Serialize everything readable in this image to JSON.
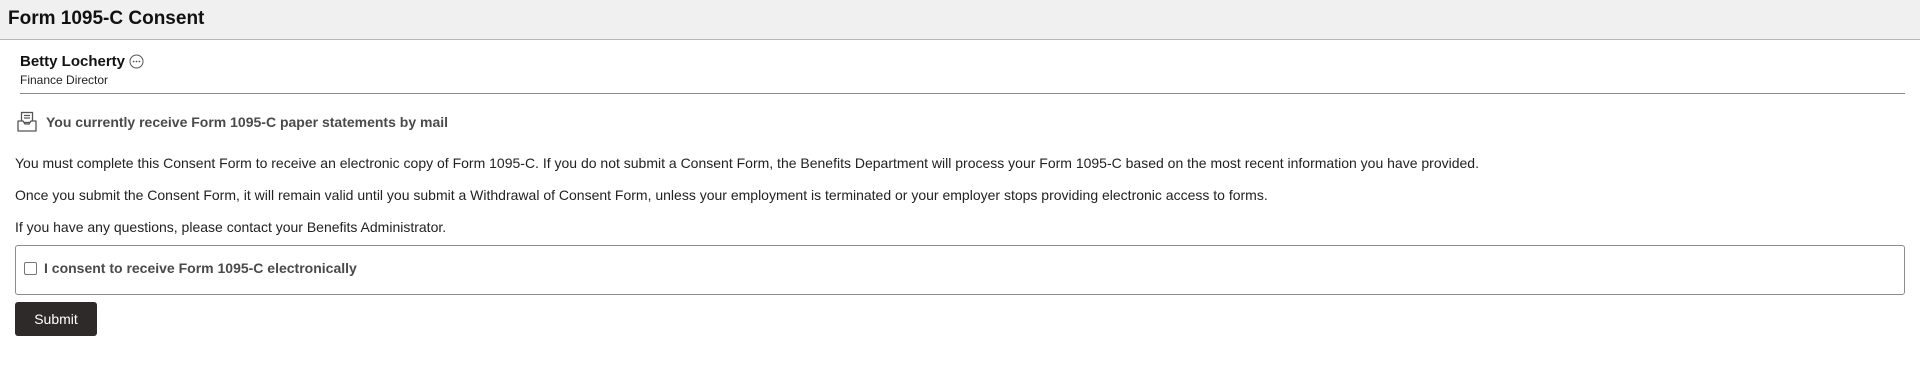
{
  "header": {
    "title": "Form 1095-C Consent"
  },
  "person": {
    "name": "Betty Locherty",
    "role": "Finance Director",
    "more_icon": "more-options-icon"
  },
  "notice": {
    "icon": "mail-tray-icon",
    "text": "You currently receive Form 1095-C paper statements by mail"
  },
  "paragraphs": [
    "You must complete this Consent Form to receive an electronic copy of Form 1095-C.  If you do not submit a Consent Form, the Benefits Department will process your Form 1095-C based on the most recent information you have provided.",
    "Once you submit the Consent Form, it will remain valid until you submit a Withdrawal of Consent Form, unless your employment is terminated or your employer stops providing electronic access to forms.",
    "If you have any questions, please contact your Benefits Administrator."
  ],
  "consent": {
    "label": "I consent to receive Form 1095-C electronically",
    "checked": false
  },
  "submit": {
    "label": "Submit"
  },
  "colors": {
    "header_bg": "#f0f0f0",
    "button_bg": "#2e2a29",
    "text": "#222222",
    "muted_bold": "#4a4a4a"
  }
}
